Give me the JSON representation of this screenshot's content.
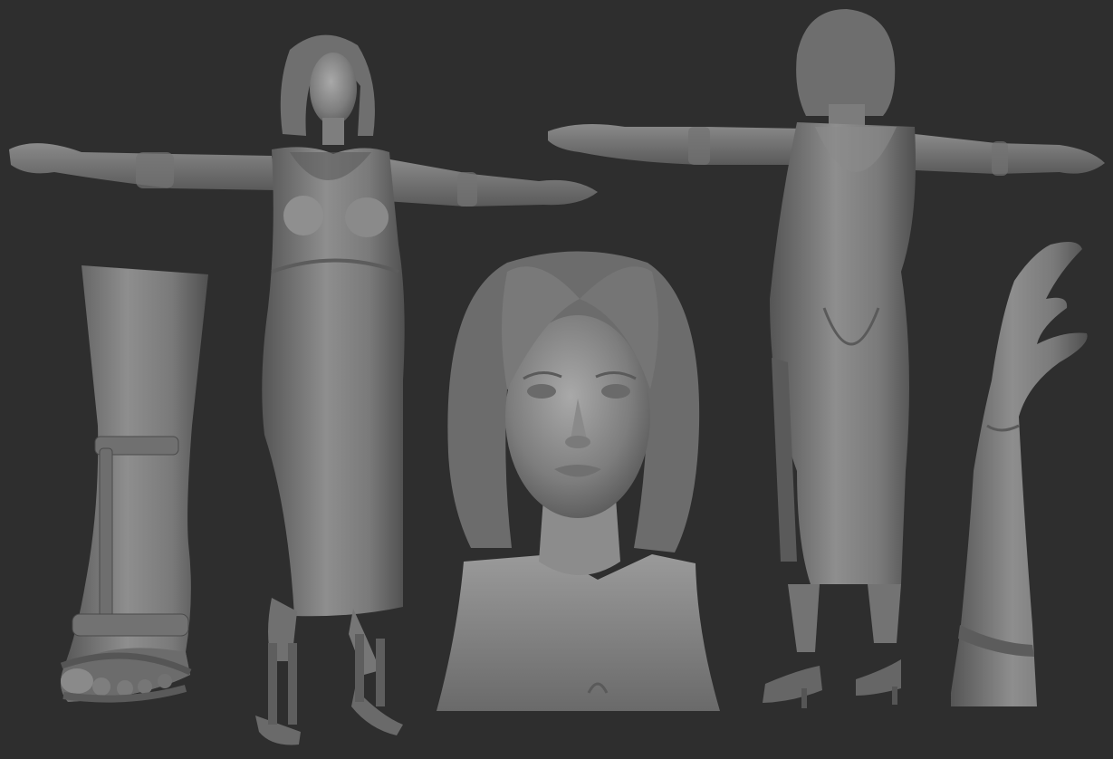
{
  "scene": {
    "background_color": "#2e2e2e",
    "clay_color": "#7a7a7a",
    "clay_highlight": "#a9a9a9",
    "clay_shadow": "#4f4f4f",
    "render_style": "grey clay 3D sculpt turnaround",
    "views": [
      {
        "name": "foot-sandal-closeup"
      },
      {
        "name": "figure-front-t-pose"
      },
      {
        "name": "head-bust-front"
      },
      {
        "name": "figure-back-t-pose"
      },
      {
        "name": "hand-forearm-side"
      }
    ]
  }
}
